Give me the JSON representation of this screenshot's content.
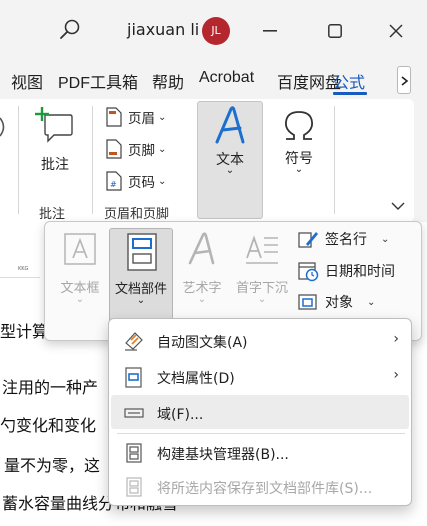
{
  "titlebar": {
    "user_name": "jiaxuan li",
    "avatar_initials": "JL",
    "avatar_color": "#b3272d"
  },
  "tabs": [
    {
      "label": "视图"
    },
    {
      "label": "PDF工具箱"
    },
    {
      "label": "帮助"
    },
    {
      "label": "Acrobat"
    },
    {
      "label": "百度网盘"
    },
    {
      "label": "公式",
      "selected": true
    }
  ],
  "accent_color": "#185abd",
  "ribbon": {
    "comment_group": {
      "button_label": "批注",
      "group_label": "批注"
    },
    "header_footer_group": {
      "items": [
        {
          "label": "页眉",
          "icon": "header-icon"
        },
        {
          "label": "页脚",
          "icon": "footer-icon"
        },
        {
          "label": "页码",
          "icon": "page-number-icon"
        }
      ],
      "group_label": "页眉和页脚"
    },
    "text_button": {
      "label": "文本"
    },
    "symbol_button": {
      "label": "符号"
    }
  },
  "gallery": {
    "big_buttons": [
      {
        "label": "文本框",
        "icon": "textbox-icon",
        "enabled": false
      },
      {
        "label": "文档部件",
        "icon": "quick-parts-icon",
        "enabled": true,
        "selected": true
      },
      {
        "label": "艺术字",
        "icon": "wordart-icon",
        "enabled": false
      },
      {
        "label": "首字下沉",
        "icon": "drop-cap-icon",
        "enabled": false
      }
    ],
    "right_items": [
      {
        "label": "签名行",
        "icon": "signature-line-icon"
      },
      {
        "label": "日期和时间",
        "icon": "date-time-icon"
      },
      {
        "label": "对象",
        "icon": "object-icon"
      }
    ]
  },
  "menu": {
    "items": [
      {
        "label": "自动图文集(A)",
        "icon": "autotext-icon",
        "submenu": true,
        "enabled": true
      },
      {
        "label": "文档属性(D)",
        "icon": "document-property-icon",
        "submenu": true,
        "enabled": true
      },
      {
        "label": "域(F)...",
        "icon": "field-icon",
        "submenu": false,
        "enabled": true,
        "hovered": true
      },
      {
        "label": "构建基块管理器(B)...",
        "icon": "building-blocks-icon",
        "submenu": false,
        "enabled": true
      },
      {
        "label": "将所选内容保存到文档部件库(S)...",
        "icon": "save-selection-icon",
        "submenu": false,
        "enabled": false
      }
    ]
  },
  "document": {
    "thumb_caption": "KKG",
    "lines": [
      "型计算",
      "注用的一种产",
      "勺变化和变化",
      "量不为零，这",
      "蓄水容量曲线分布和融雪"
    ]
  }
}
